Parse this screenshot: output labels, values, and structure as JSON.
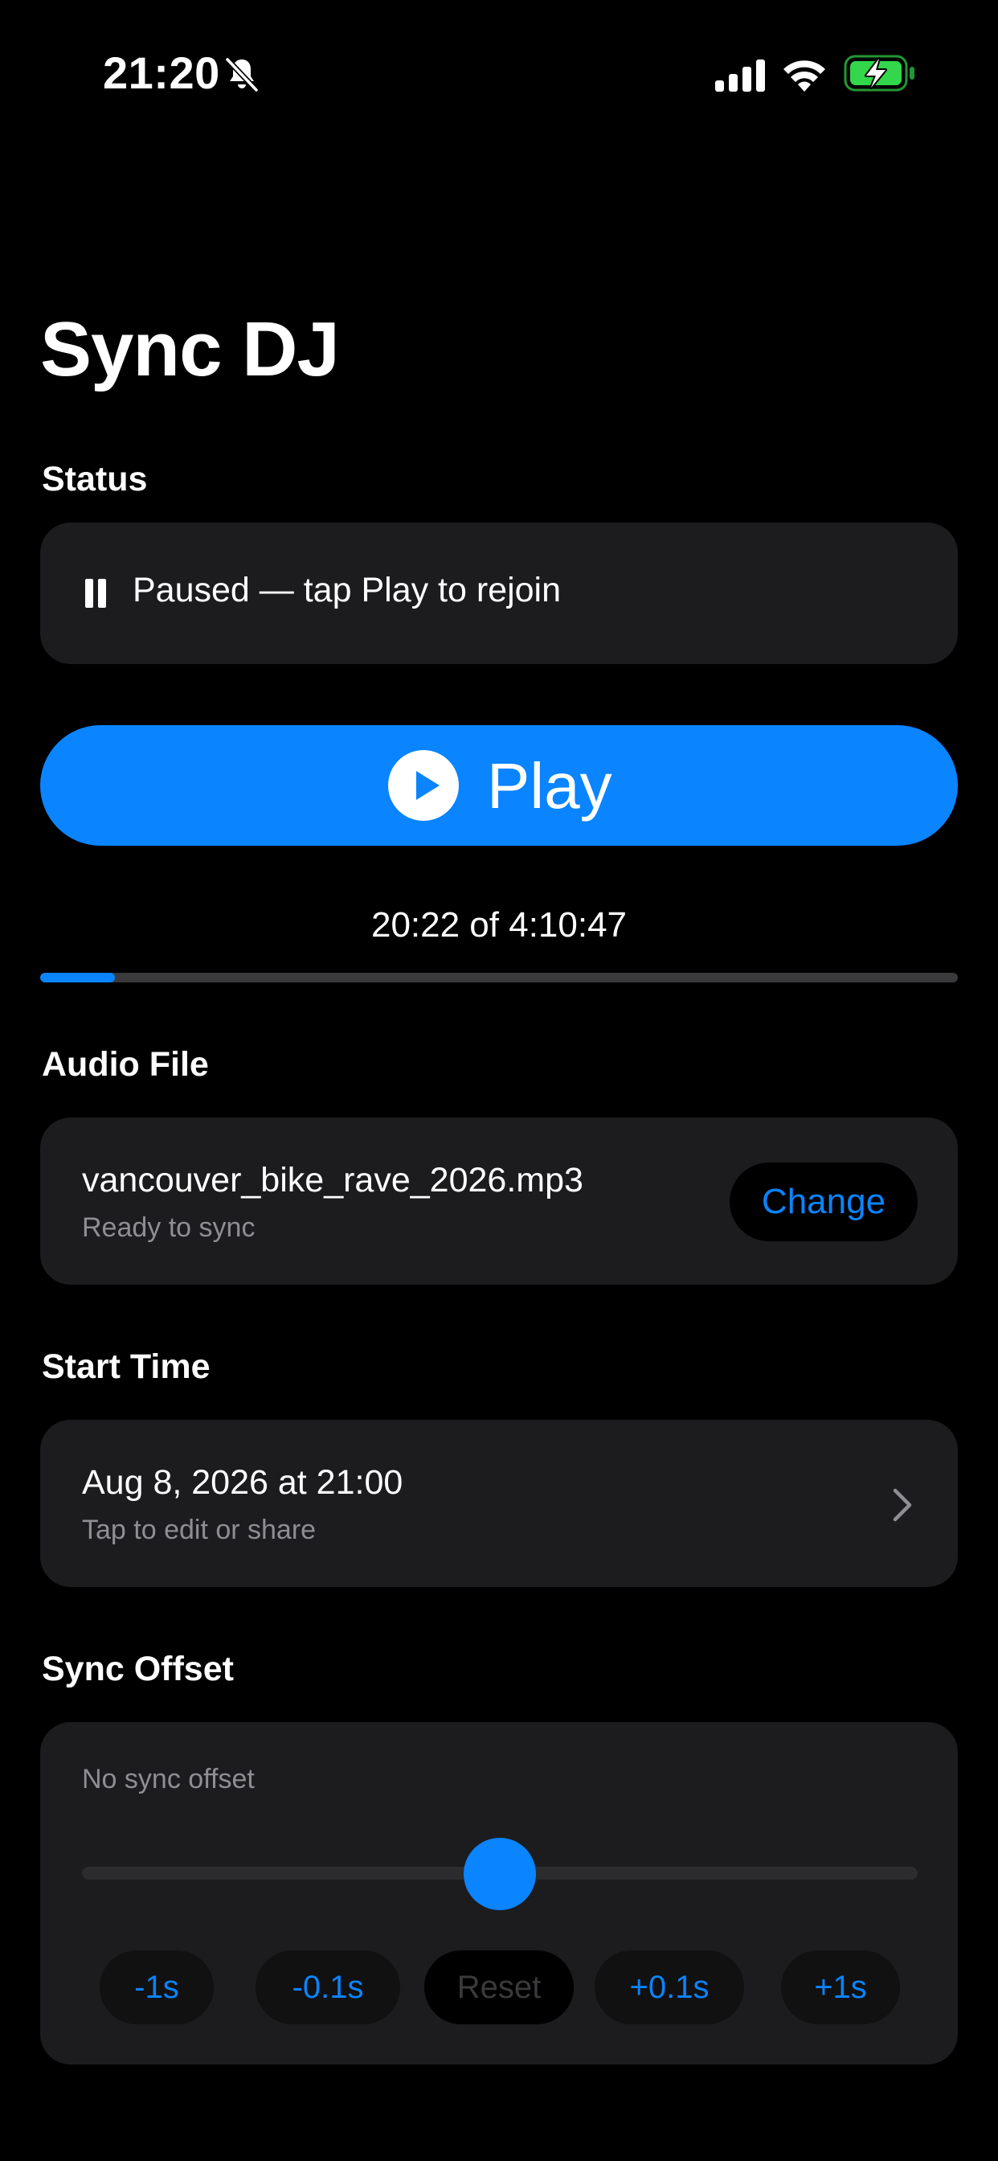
{
  "status_bar": {
    "time": "21:20"
  },
  "app": {
    "title": "Sync DJ"
  },
  "status": {
    "section_title": "Status",
    "text": "Paused — tap Play to rejoin"
  },
  "player": {
    "play_label": "Play",
    "progress_text": "20:22 of 4:10:47",
    "progress_fraction": 0.081,
    "accent_color": "#0a84ff"
  },
  "audio_file": {
    "section_title": "Audio File",
    "file_name": "vancouver_bike_rave_2026.mp3",
    "subtitle": "Ready to sync",
    "change_label": "Change"
  },
  "start_time": {
    "section_title": "Start Time",
    "value": "Aug 8, 2026 at 21:00",
    "subtitle": "Tap to edit or share"
  },
  "sync_offset": {
    "section_title": "Sync Offset",
    "label": "No sync offset",
    "slider_fraction": 0.5,
    "buttons": [
      "-1s",
      "-0.1s",
      "Reset",
      "+0.1s",
      "+1s"
    ]
  }
}
